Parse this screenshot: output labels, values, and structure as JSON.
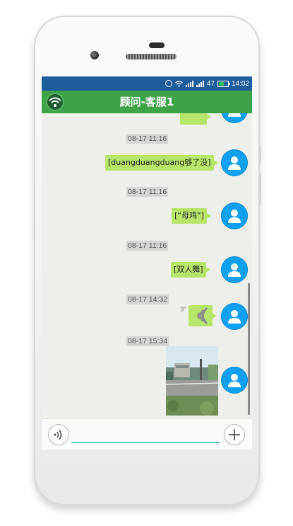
{
  "status_bar": {
    "battery_percent": "47",
    "time": "14:02"
  },
  "header": {
    "title": "顾问-客服1",
    "left_icon": "wifi-icon"
  },
  "messages": [
    {
      "timestamp": "08-17 11:16",
      "text": "[duangduangduang够了没]"
    },
    {
      "timestamp": "08-17 11:16",
      "text": "[“母鸡”]"
    },
    {
      "timestamp": "08-17 11:16",
      "text": "[双人舞]"
    },
    {
      "timestamp": "08-17 14:32",
      "voice_duration": "3\"",
      "icon": "voice-wave-icon"
    },
    {
      "timestamp": "08-17 15:34",
      "image": "street-photo"
    }
  ],
  "input_bar": {
    "left_icon": "voice-input-icon",
    "text_value": "",
    "right_icon": "plus-icon"
  },
  "colors": {
    "title_bar": "#3fa349",
    "status_bar": "#1e5d9b",
    "bubble": "#b7e46b",
    "avatar": "#0fa1f0",
    "input_underline": "#5dc6c6"
  }
}
